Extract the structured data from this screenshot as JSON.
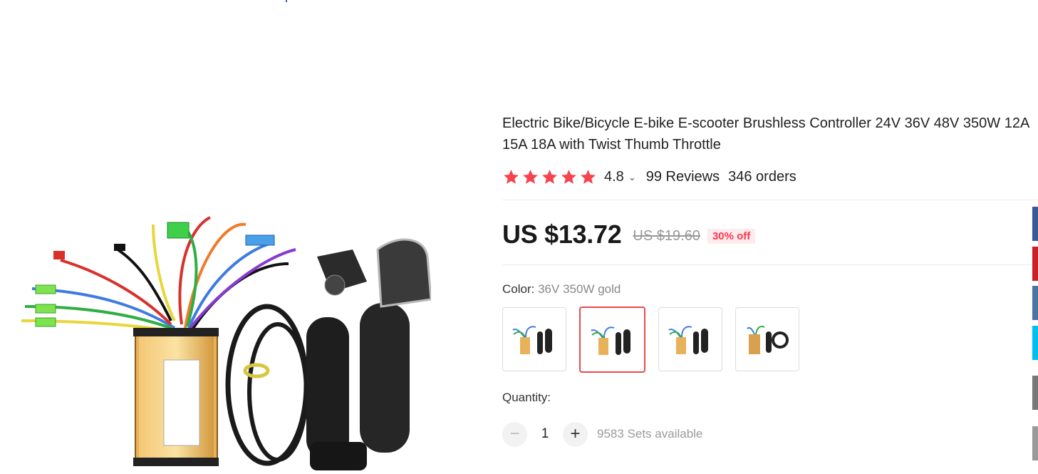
{
  "product": {
    "title": "Electric Bike/Bicycle E-bike E-scooter Brushless Controller 24V 36V 48V 350W 12A 15A 18A with Twist Thumb Throttle",
    "rating": "4.8",
    "reviews": "99 Reviews",
    "orders": "346 orders",
    "price": "US $13.72",
    "original_price": "US $19.60",
    "discount": "30% off",
    "color_label": "Color:",
    "color_value": "36V 350W gold",
    "quantity_label": "Quantity:",
    "quantity": "1",
    "available": "9583 Sets available",
    "stars": 5
  },
  "colors": {
    "star": "#f6434e",
    "price_discount": "#fd384f",
    "selected_border": "#e74c4c",
    "share_facebook": "#3b5998",
    "share_pinterest": "#cb2027",
    "share_vk": "#4c75a3",
    "share_twitter": "#00c0ef",
    "share_gray": "#777777"
  },
  "icons": {
    "minus": "−",
    "plus": "+",
    "chevron": "⌄"
  }
}
